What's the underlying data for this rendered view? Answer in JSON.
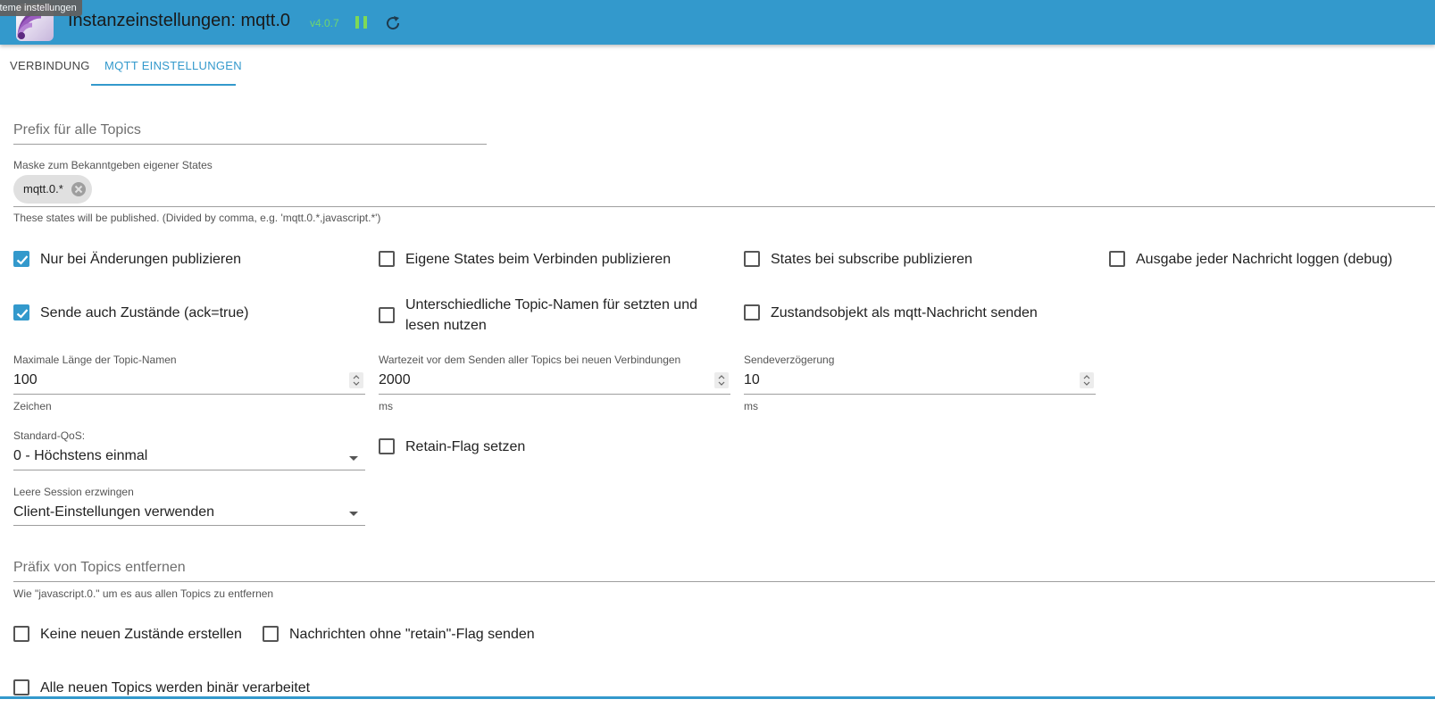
{
  "tooltip": "steme instellungen",
  "header": {
    "title": "Instanzeinstellungen: mqtt.0",
    "version": "v4.0.7"
  },
  "tabs": [
    {
      "label": "VERBINDUNG"
    },
    {
      "label": "MQTT EINSTELLUNGEN"
    }
  ],
  "prefix": {
    "placeholder": "Prefix für alle Topics"
  },
  "mask": {
    "label": "Maske zum Bekanntgeben eigener States",
    "chip": "mqtt.0.*",
    "helper": "These states will be published. (Divided by comma, e.g. 'mqtt.0.*,javascript.*')"
  },
  "checkboxes_row1": [
    {
      "label": "Nur bei Änderungen publizieren",
      "checked": true
    },
    {
      "label": "Eigene States beim Verbinden publizieren",
      "checked": false
    },
    {
      "label": "States bei subscribe publizieren",
      "checked": false
    },
    {
      "label": "Ausgabe jeder Nachricht loggen (debug)",
      "checked": false
    }
  ],
  "checkboxes_row2": [
    {
      "label": "Sende auch Zustände (ack=true)",
      "checked": true
    },
    {
      "label_line1": "Unterschiedliche Topic-Namen für setzten und",
      "label_line2": "lesen nutzen",
      "checked": false
    },
    {
      "label": "Zustandsobjekt als mqtt-Nachricht senden",
      "checked": false
    }
  ],
  "numbers": [
    {
      "label": "Maximale Länge der Topic-Namen",
      "value": "100",
      "unit": "Zeichen"
    },
    {
      "label": "Wartezeit vor dem Senden aller Topics bei neuen Verbindungen",
      "value": "2000",
      "unit": "ms"
    },
    {
      "label": "Sendeverzögerung",
      "value": "10",
      "unit": "ms"
    }
  ],
  "qos": {
    "label": "Standard-QoS:",
    "value": "0 - Höchstens einmal"
  },
  "retain": {
    "label": "Retain-Flag setzen",
    "checked": false
  },
  "session": {
    "label": "Leere Session erzwingen",
    "value": "Client-Einstellungen verwenden"
  },
  "remove_prefix": {
    "placeholder": "Präfix von Topics entfernen",
    "helper": "Wie \"javascript.0.\" um es aus allen Topics zu entfernen"
  },
  "checkboxes_bottom": [
    {
      "label": "Keine neuen Zustände erstellen",
      "checked": false
    },
    {
      "label": "Nachrichten ohne \"retain\"-Flag senden",
      "checked": false
    },
    {
      "label": "Alle neuen Topics werden binär verarbeitet",
      "checked": false
    }
  ],
  "colors": {
    "accent": "#3399cc",
    "version": "#6fd66f"
  }
}
